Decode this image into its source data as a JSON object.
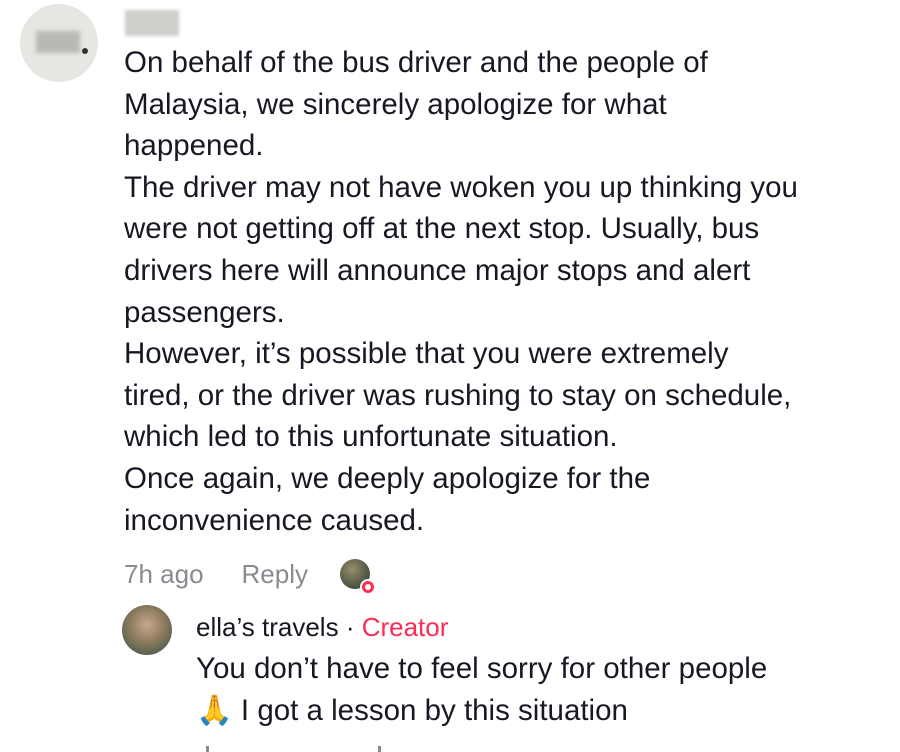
{
  "comment": {
    "username": "",
    "paragraphs": "On behalf of the bus driver and the people of\nMalaysia, we sincerely apologize for what\nhappened.\nThe driver may not have woken you up thinking you\nwere not getting off at the next stop. Usually, bus\ndrivers here will announce major stops and alert\npassengers.\nHowever, it’s possible that you were extremely\ntired, or the driver was rushing to stay on schedule,\nwhich led to this unfortunate situation.\nOnce again, we deeply apologize for the\ninconvenience caused.",
    "time": "7h ago",
    "reply_label": "Reply",
    "liked_by_creator_icon": "creator-liked-avatar-icon"
  },
  "reply": {
    "username": "ella’s travels",
    "separator": " · ",
    "badge": "Creator",
    "text": "You don’t have to feel sorry for other people\n🙏 I got a lesson by this situation"
  },
  "colors": {
    "text": "#161823",
    "muted": "#8a8b91",
    "accent": "#fe2c55"
  }
}
